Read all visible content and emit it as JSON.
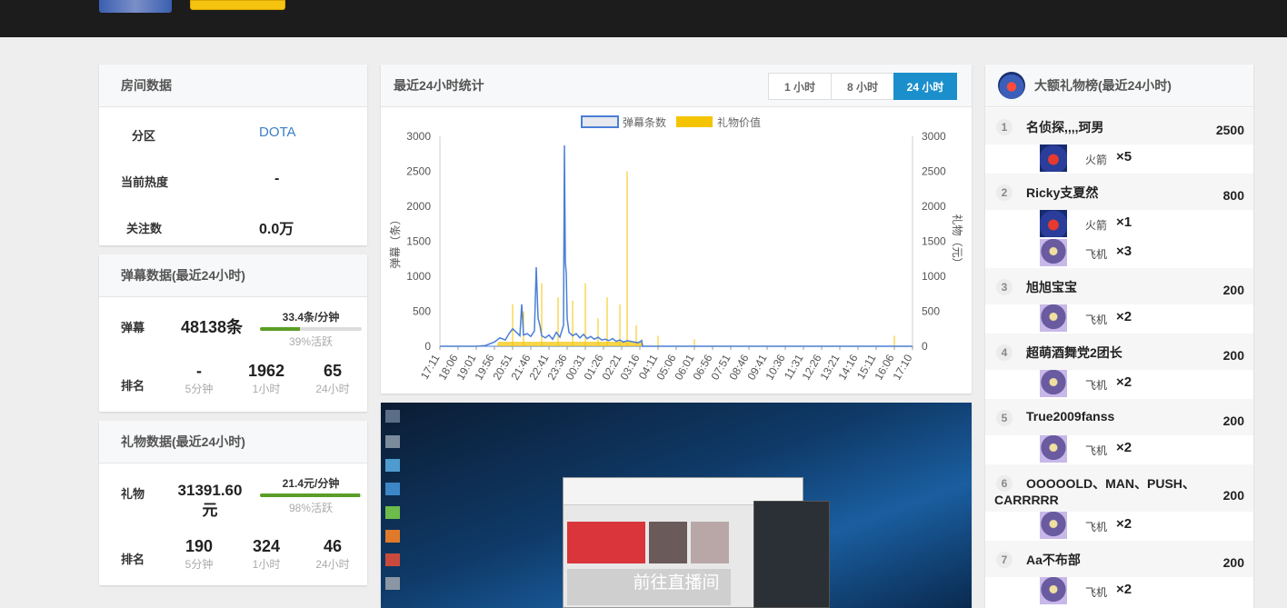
{
  "room": {
    "title": "房间数据",
    "zone_label": "分区",
    "zone_value": "DOTA",
    "heat_label": "当前热度",
    "heat_value": "-",
    "followers_label": "关注数",
    "followers_value": "0.0万"
  },
  "danmu": {
    "title": "弹幕数据(最近24小时)",
    "label": "弹幕",
    "value": "48138条",
    "rate": "33.4条/分钟",
    "active_text": "39%活跃",
    "active_fraction": 0.39,
    "rank_label": "排名",
    "ranks": [
      {
        "value": "-",
        "period": "5分钟"
      },
      {
        "value": "1962",
        "period": "1小时"
      },
      {
        "value": "65",
        "period": "24小时"
      }
    ]
  },
  "gift": {
    "title": "礼物数据(最近24小时)",
    "label": "礼物",
    "value_line1": "31391.60",
    "value_line2": "元",
    "rate": "21.4元/分钟",
    "active_text": "98%活跃",
    "active_fraction": 0.98,
    "rank_label": "排名",
    "ranks": [
      {
        "value": "190",
        "period": "5分钟"
      },
      {
        "value": "324",
        "period": "1小时"
      },
      {
        "value": "46",
        "period": "24小时"
      }
    ]
  },
  "stats": {
    "title": "最近24小时统计",
    "tabs": [
      {
        "label": "1 小时",
        "active": false
      },
      {
        "label": "8 小时",
        "active": false
      },
      {
        "label": "24 小时",
        "active": true
      }
    ]
  },
  "chart_data": {
    "type": "line",
    "legend": [
      "弹幕条数",
      "礼物价值"
    ],
    "ylabel_left": "弹幕（条）",
    "ylabel_right": "礼物（元）",
    "y_ticks": [
      "0",
      "500",
      "1000",
      "1500",
      "2000",
      "2500",
      "3000"
    ],
    "ylim": [
      0,
      3000
    ],
    "x_ticks": [
      "17:11",
      "18:06",
      "19:01",
      "19:56",
      "20:51",
      "21:46",
      "22:41",
      "23:36",
      "00:31",
      "01:26",
      "02:21",
      "03:16",
      "04:11",
      "05:06",
      "06:01",
      "06:56",
      "07:51",
      "08:46",
      "09:41",
      "10:36",
      "11:31",
      "12:26",
      "13:21",
      "14:16",
      "15:11",
      "16:06",
      "17:10"
    ],
    "series": [
      {
        "name": "弹幕条数",
        "color": "#4a7fd6",
        "x": [
          0,
          2,
          2.5,
          3,
          3.3,
          3.6,
          3.8,
          4.0,
          4.2,
          4.4,
          4.5,
          4.6,
          4.8,
          5.0,
          5.2,
          5.3,
          5.4,
          5.5,
          5.6,
          5.8,
          6.0,
          6.2,
          6.4,
          6.6,
          6.8,
          6.85,
          6.9,
          6.95,
          7.0,
          7.1,
          7.3,
          7.5,
          7.7,
          7.9,
          8.1,
          8.3,
          8.5,
          8.7,
          8.9,
          9.1,
          9.3,
          9.5,
          9.7,
          9.9,
          10.1,
          10.3,
          10.5,
          10.7,
          10.9,
          11.1,
          11.15,
          12,
          18,
          26
        ],
        "values": [
          0,
          0,
          10,
          60,
          120,
          90,
          180,
          250,
          200,
          150,
          600,
          160,
          180,
          140,
          220,
          1130,
          400,
          300,
          150,
          120,
          160,
          100,
          200,
          130,
          300,
          2870,
          1200,
          1050,
          400,
          200,
          150,
          180,
          120,
          170,
          110,
          140,
          100,
          130,
          90,
          100,
          80,
          110,
          70,
          90,
          60,
          80,
          70,
          60,
          50,
          80,
          0,
          0,
          0,
          0
        ]
      },
      {
        "name": "礼物价值",
        "color": "#f5c400",
        "x": [
          3.2,
          4.0,
          4.6,
          5.6,
          6.5,
          7.3,
          8.0,
          8.7,
          9.2,
          9.9,
          10.3,
          10.8,
          11.1,
          12,
          14,
          25
        ],
        "values": [
          40,
          600,
          500,
          900,
          700,
          650,
          900,
          400,
          700,
          600,
          2500,
          300,
          100,
          150,
          100,
          150
        ]
      }
    ]
  },
  "live": {
    "cta": "前往直播间"
  },
  "ranking": {
    "title": "大额礼物榜(最近24小时)",
    "items": [
      {
        "rank": "1",
        "name": "名侦探,,,,珂男",
        "value": "2500",
        "gifts": [
          {
            "icon": "rocket-gift-icon",
            "name": "火箭",
            "count": "×5"
          }
        ]
      },
      {
        "rank": "2",
        "name": "Ricky支夏然",
        "value": "800",
        "gifts": [
          {
            "icon": "rocket-gift-icon",
            "name": "火箭",
            "count": "×1"
          },
          {
            "icon": "plane-gift-icon",
            "name": "飞机",
            "count": "×3"
          }
        ]
      },
      {
        "rank": "3",
        "name": "旭旭宝宝",
        "value": "200",
        "gifts": [
          {
            "icon": "plane-gift-icon",
            "name": "飞机",
            "count": "×2"
          }
        ]
      },
      {
        "rank": "4",
        "name": "超萌酒舞党2团长",
        "value": "200",
        "gifts": [
          {
            "icon": "plane-gift-icon",
            "name": "飞机",
            "count": "×2"
          }
        ]
      },
      {
        "rank": "5",
        "name": "True2009fanss",
        "value": "200",
        "gifts": [
          {
            "icon": "plane-gift-icon",
            "name": "飞机",
            "count": "×2"
          }
        ]
      },
      {
        "rank": "6",
        "name": "OOOOOLD、MAN、PUSH、",
        "name2": "CARRRRR",
        "value": "200",
        "gifts": [
          {
            "icon": "plane-gift-icon",
            "name": "飞机",
            "count": "×2"
          }
        ]
      },
      {
        "rank": "7",
        "name": "Aa不布部",
        "value": "200",
        "gifts": [
          {
            "icon": "plane-gift-icon",
            "name": "飞机",
            "count": "×2"
          }
        ]
      }
    ]
  },
  "colors": {
    "accent": "#1b8fcc",
    "danmu_line": "#4a7fd6",
    "gift_bar": "#f5c400",
    "progress": "#5a9e26",
    "topbar": "#1c1c1c"
  }
}
